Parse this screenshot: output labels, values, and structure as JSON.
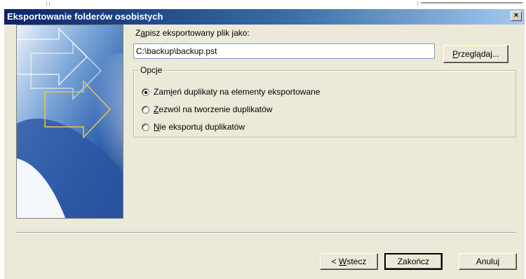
{
  "window": {
    "title": "Eksportowanie folderów osobistych",
    "close_glyph": "×"
  },
  "save_as": {
    "label_prefix": "Z",
    "label_mnemonic": "a",
    "label_suffix": "pisz eksportowany plik jako:",
    "value": "C:\\backup\\backup.pst"
  },
  "browse_button": {
    "mnemonic": "P",
    "rest": "rzeglądaj..."
  },
  "options": {
    "legend": "Opcje",
    "items": [
      {
        "mnemonic": "",
        "pre": "Zam",
        "mn": "i",
        "post": "eń duplikaty na elementy eksportowane",
        "checked": true
      },
      {
        "pre": "",
        "mn": "Z",
        "post": "ezwól na tworzenie duplikatów",
        "checked": false
      },
      {
        "pre": "",
        "mn": "N",
        "post": "ie eksportuj duplikatów",
        "checked": false
      }
    ]
  },
  "buttons": {
    "back_pre": "< ",
    "back_mn": "W",
    "back_post": "stecz",
    "finish": "Zakończ",
    "cancel": "Anuluj"
  },
  "colors": {
    "highlight": "#fff500",
    "titlebar": "#0a246a",
    "dialog_bg": "#ece9d8"
  }
}
